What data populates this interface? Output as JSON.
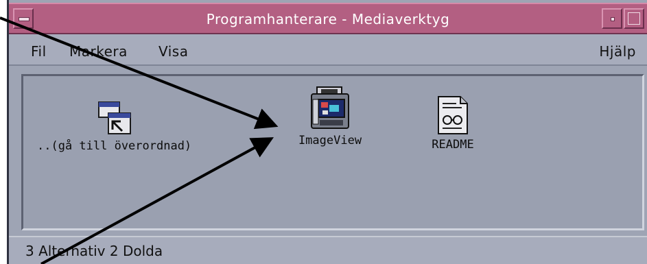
{
  "window": {
    "title": "Programhanterare - Mediaverktyg"
  },
  "menubar": {
    "items": [
      {
        "label": "Fil"
      },
      {
        "label": "Markera"
      },
      {
        "label": "Visa"
      }
    ],
    "help_label": "Hjälp"
  },
  "icons": [
    {
      "label": "..(gå till överordnad)",
      "icon": "parent-folder-icon"
    },
    {
      "label": "ImageView",
      "icon": "imageview-app-icon"
    },
    {
      "label": "README",
      "icon": "readme-document-icon"
    }
  ],
  "status": {
    "text": "3 Alternativ 2 Dolda"
  },
  "colors": {
    "titlebar": "#b35f82",
    "window_bg": "#9ea4b4",
    "callout_arrows": "#000000"
  }
}
